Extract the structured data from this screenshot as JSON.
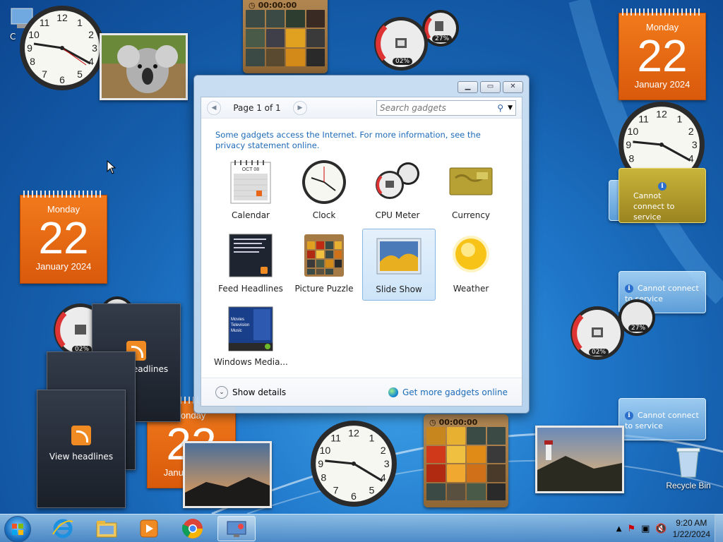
{
  "desktop": {
    "calendars": [
      {
        "day": "Monday",
        "date": "22",
        "month": "January 2024"
      },
      {
        "day": "Monday",
        "date": "22",
        "month": "January 2024"
      },
      {
        "day": "Monday",
        "date": "22",
        "month": "January 2024"
      }
    ],
    "cpu": {
      "cpu_pct": "02%",
      "mem_pct": "27%"
    },
    "puzzle_timer": "00:00:00",
    "feed_label": "View headlines",
    "feed_partial": "eadlines",
    "cal_partial_day": "londay",
    "no_connection_text": "Cannot connect to service",
    "recycle_bin": "Recycle Bin",
    "desktop_icon_letter": "C"
  },
  "gallery": {
    "page_label": "Page 1 of 1",
    "search_placeholder": "Search gadgets",
    "notice": "Some gadgets access the Internet.  For more information, see the privacy statement online.",
    "items": [
      {
        "label": "Calendar"
      },
      {
        "label": "Clock"
      },
      {
        "label": "CPU Meter"
      },
      {
        "label": "Currency"
      },
      {
        "label": "Feed Headlines"
      },
      {
        "label": "Picture Puzzle"
      },
      {
        "label": "Slide Show"
      },
      {
        "label": "Weather"
      },
      {
        "label": "Windows Media..."
      }
    ],
    "selected": "Slide Show",
    "show_details": "Show details",
    "get_more": "Get more gadgets online",
    "calendar_icon_month": "OCT 08",
    "media_icon_lines": [
      "Movies",
      "Television",
      "Music"
    ]
  },
  "taskbar": {
    "time": "9:20 AM",
    "date": "1/22/2024"
  },
  "colors": {
    "calendar_orange": "#e8650f",
    "link_blue": "#1e6bb8",
    "desktop_blue": "#1f76c9"
  }
}
